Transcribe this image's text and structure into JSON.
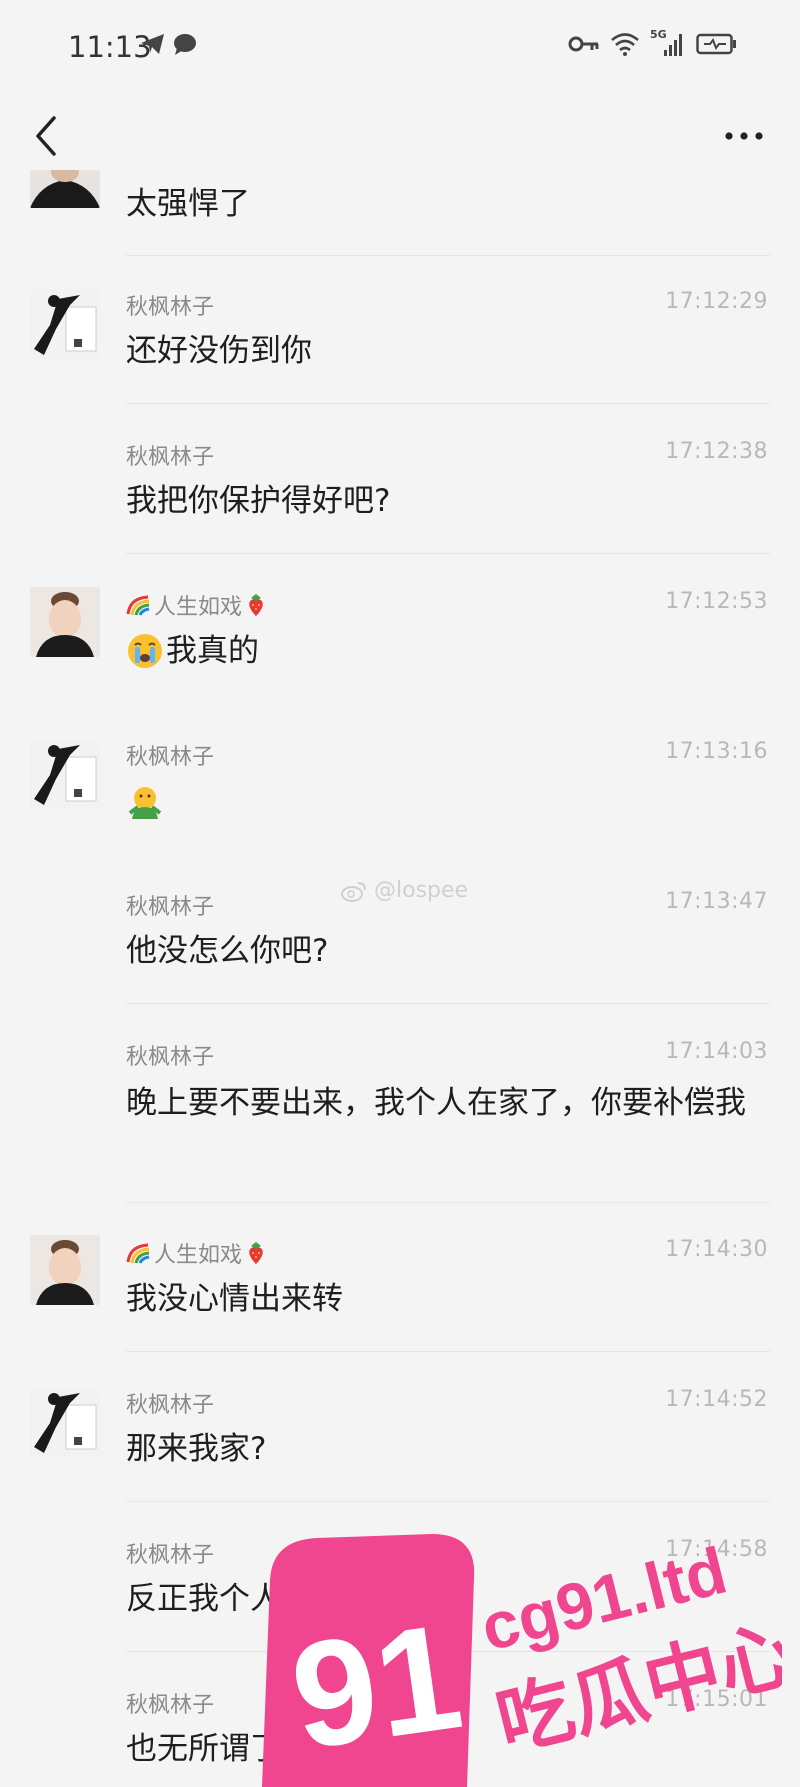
{
  "status_bar": {
    "time": "11:13",
    "network": "5G"
  },
  "nav": {
    "back_icon": "chevron-left-icon",
    "more_icon": "more-horizontal-icon"
  },
  "messages": [
    {
      "sender": "",
      "time": "",
      "text": "太强悍了"
    },
    {
      "sender": "秋枫林子",
      "time": "17:12:29",
      "text": "还好没伤到你"
    },
    {
      "sender": "秋枫林子",
      "time": "17:12:38",
      "text": "我把你保护得好吧?"
    },
    {
      "sender": "人生如戏",
      "time": "17:12:53",
      "text": "我真的"
    },
    {
      "sender": "秋枫林子",
      "time": "17:13:16",
      "text": ""
    },
    {
      "sender": "秋枫林子",
      "time": "17:13:47",
      "text": "他没怎么你吧?"
    },
    {
      "sender": "秋枫林子",
      "time": "17:14:03",
      "text": "晚上要不要出来，我个人在家了，你要补偿我"
    },
    {
      "sender": "人生如戏",
      "time": "17:14:30",
      "text": "我没心情出来转"
    },
    {
      "sender": "秋枫林子",
      "time": "17:14:52",
      "text": "那来我家?"
    },
    {
      "sender": "秋枫林子",
      "time": "17:14:58",
      "text": "反正我个人在家"
    },
    {
      "sender": "秋枫林子",
      "time": "17:15:01",
      "text": "也无所谓了"
    }
  ],
  "watermark": {
    "weibo_handle": "@lospee",
    "promo_number": "91",
    "promo_domain": "cg91.ltd",
    "promo_title": "吃瓜中心"
  },
  "colors": {
    "background": "#f4f4f4",
    "promo_pink": "#f0468f"
  }
}
